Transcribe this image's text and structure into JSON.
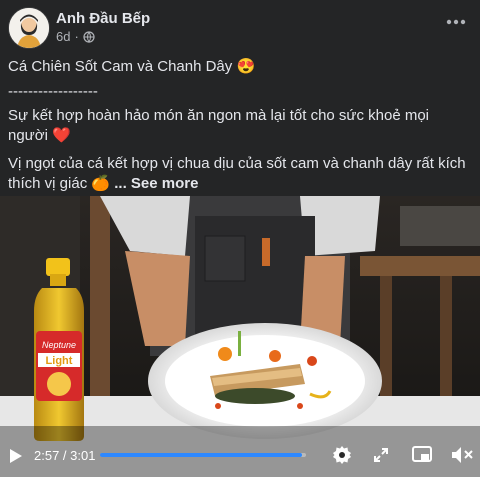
{
  "post": {
    "page_name": "Anh Đầu Bếp",
    "age": "6d",
    "privacy_icon": "globe-icon",
    "title": "Cá Chiên Sốt Cam và Chanh Dây 😍",
    "divider": "------------------",
    "line1": "Sự kết hợp hoàn hảo món ăn ngon mà lại tốt cho sức khoẻ mọi người",
    "line1_emoji": "❤️",
    "line2": "Vị ngọt của cá kết hợp vị chua dịu của sốt cam và chanh dây rất kích thích vị giác",
    "line2_emoji": "🍊",
    "see_more": "... See more"
  },
  "video": {
    "product_brand": "Neptune",
    "product_label": "Light",
    "current_time": "2:57",
    "separator": " / ",
    "duration": "3:01",
    "progress": 0.98
  },
  "colors": {
    "background": "#242526",
    "text": "#e4e6eb",
    "secondary_text": "#b0b3b8",
    "progress": "#2d88ff"
  }
}
